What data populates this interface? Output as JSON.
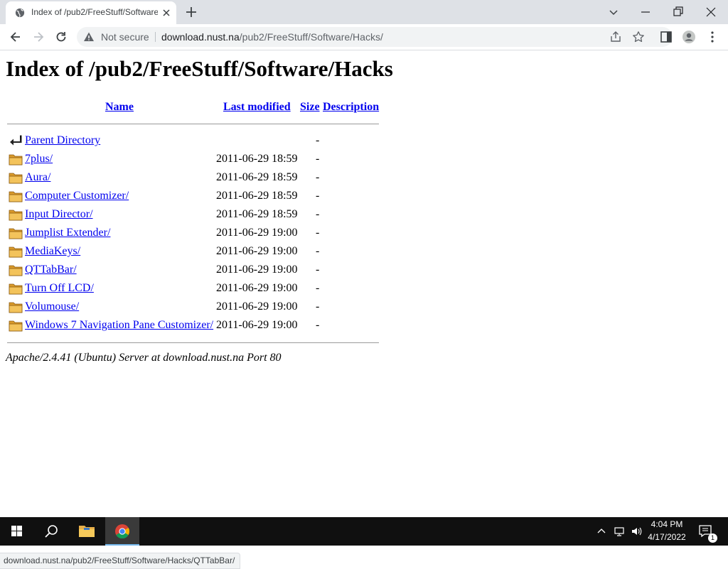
{
  "browser": {
    "tab_title": "Index of /pub2/FreeStuff/Software/Hacks",
    "security_label": "Not secure",
    "url_host": "download.nust.na",
    "url_path": "/pub2/FreeStuff/Software/Hacks/",
    "status_url": "download.nust.na/pub2/FreeStuff/Software/Hacks/QTTabBar/"
  },
  "page": {
    "title": "Index of /pub2/FreeStuff/Software/Hacks",
    "columns": {
      "name": "Name",
      "last_modified": "Last modified",
      "size": "Size",
      "description": "Description"
    },
    "entries": [
      {
        "name": "Parent Directory",
        "modified": "",
        "size": "-",
        "icon": "parent-directory-icon"
      },
      {
        "name": "7plus/",
        "modified": "2011-06-29 18:59",
        "size": "-",
        "icon": "folder-icon"
      },
      {
        "name": "Aura/",
        "modified": "2011-06-29 18:59",
        "size": "-",
        "icon": "folder-icon"
      },
      {
        "name": "Computer Customizer/",
        "modified": "2011-06-29 18:59",
        "size": "-",
        "icon": "folder-icon"
      },
      {
        "name": "Input Director/",
        "modified": "2011-06-29 18:59",
        "size": "-",
        "icon": "folder-icon"
      },
      {
        "name": "Jumplist Extender/",
        "modified": "2011-06-29 19:00",
        "size": "-",
        "icon": "folder-icon"
      },
      {
        "name": "MediaKeys/",
        "modified": "2011-06-29 19:00",
        "size": "-",
        "icon": "folder-icon"
      },
      {
        "name": "QTTabBar/",
        "modified": "2011-06-29 19:00",
        "size": "-",
        "icon": "folder-icon"
      },
      {
        "name": "Turn Off LCD/",
        "modified": "2011-06-29 19:00",
        "size": "-",
        "icon": "folder-icon"
      },
      {
        "name": "Volumouse/",
        "modified": "2011-06-29 19:00",
        "size": "-",
        "icon": "folder-icon"
      },
      {
        "name": "Windows 7 Navigation Pane Customizer/",
        "modified": "2011-06-29 19:00",
        "size": "-",
        "icon": "folder-icon"
      }
    ],
    "server_signature": "Apache/2.4.41 (Ubuntu) Server at download.nust.na Port 80"
  },
  "taskbar": {
    "time": "4:04 PM",
    "date": "4/17/2022",
    "notification_count": "1"
  },
  "colors": {
    "link": "#0000ee",
    "tabbar_bg": "#dee1e6",
    "taskbar_bg": "#101010",
    "folder": "#e8b04a"
  }
}
